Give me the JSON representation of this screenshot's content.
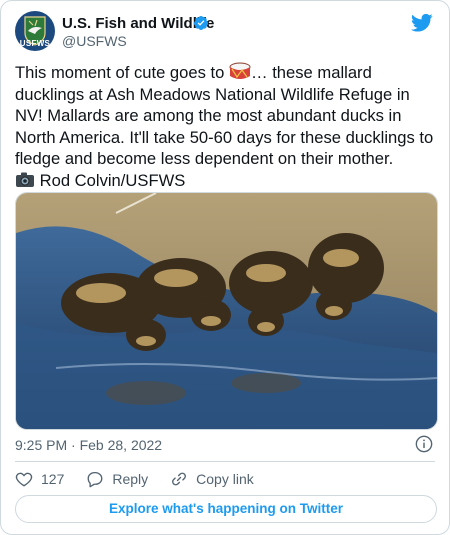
{
  "account": {
    "name": "U.S. Fish and Wildlife",
    "handle": "@USFWS",
    "avatar_text": "USFWS"
  },
  "tweet": {
    "text_before_emoji": "This moment of cute goes to ",
    "emoji": "drum-emoji",
    "text_after_emoji": "… these mallard ducklings at Ash Meadows National Wildlife Refuge in NV! Mallards are among the most abundant ducks in North America. It'll take 50-60 days for these ducklings to fledge and become less dependent on their mother.",
    "credit_icon": "camera-emoji",
    "credit": "Rod Colvin/USFWS",
    "timestamp": "9:25 PM · Feb 28, 2022"
  },
  "actions": {
    "like_count": "127",
    "reply_label": "Reply",
    "copy_label": "Copy link"
  },
  "explore_label": "Explore what's happening on Twitter",
  "colors": {
    "accent": "#1d9bf0",
    "secondary_text": "#536471",
    "border": "#cfd9de"
  }
}
